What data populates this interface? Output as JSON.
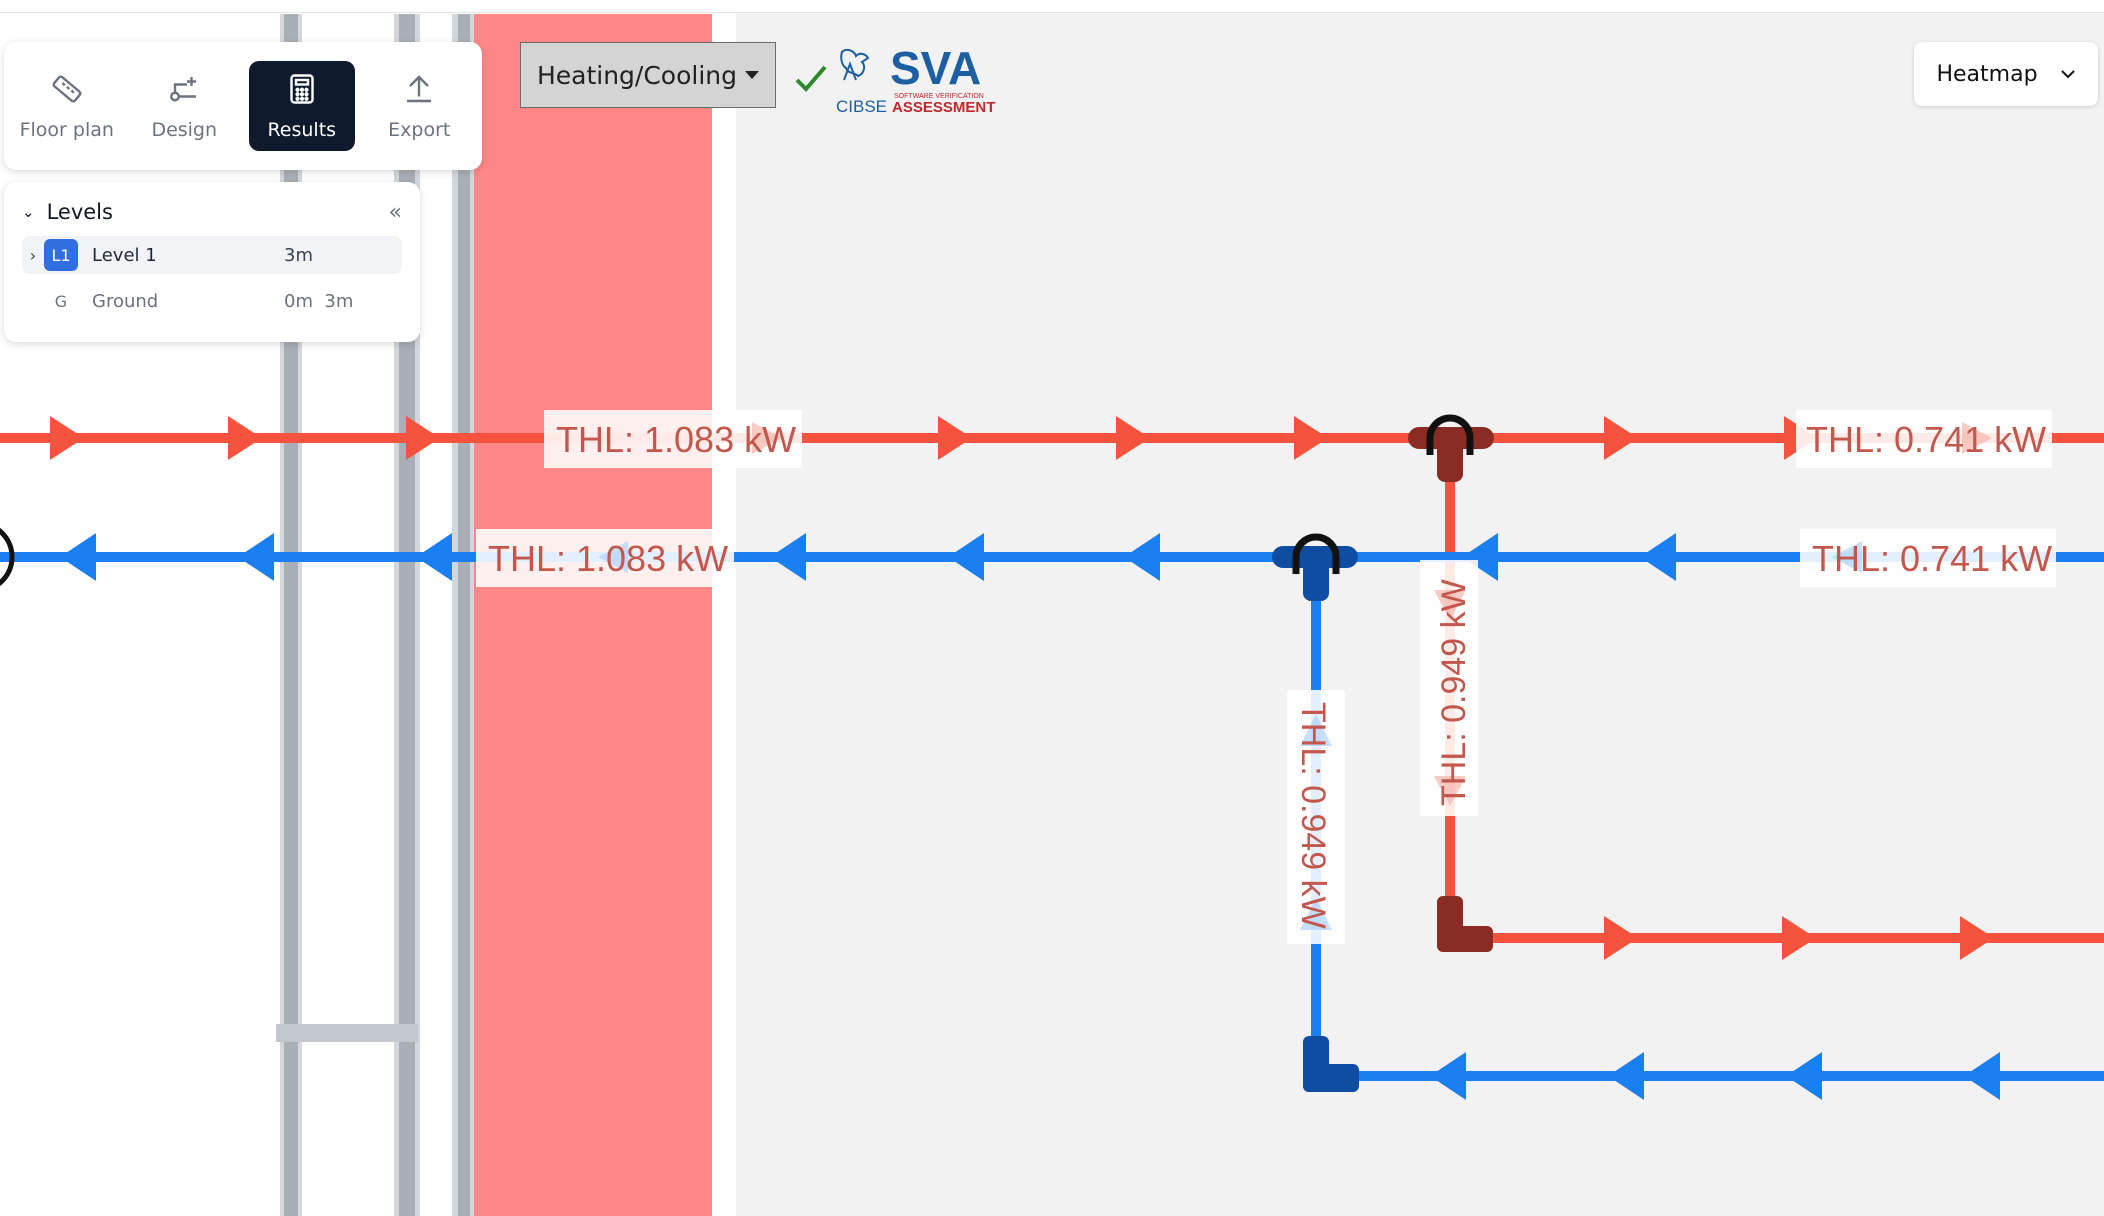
{
  "toolbar": {
    "items": [
      {
        "label": "Floor plan",
        "icon": "ruler-icon"
      },
      {
        "label": "Design",
        "icon": "design-icon"
      },
      {
        "label": "Results",
        "icon": "calculator-icon",
        "active": true
      },
      {
        "label": "Export",
        "icon": "upload-icon"
      }
    ]
  },
  "levels": {
    "title": "Levels",
    "items": [
      {
        "badge": "L1",
        "name": "Level 1",
        "value": "3m",
        "selected": true
      },
      {
        "badge": "G",
        "name": "Ground",
        "value": "0m  3m",
        "selected": false
      }
    ]
  },
  "mode_select": {
    "label": "Heating/Cooling"
  },
  "logo": {
    "brand": "SVA",
    "org": "CIBSE",
    "line1": "SOFTWARE VERIFICATION",
    "line2": "ASSESSMENT"
  },
  "heatmap": {
    "label": "Heatmap"
  },
  "pipe_labels": {
    "flow_main_left": "THL: 1.083 kW",
    "flow_main_right": "THL: 0.741 kW",
    "return_main_left": "THL: 1.083 kW",
    "return_main_right": "THL: 0.741 kW",
    "flow_branch": "THL: 0.949 kW",
    "return_branch": "THL: 0.949 kW"
  },
  "colors": {
    "flow": "#f5533d",
    "return": "#1a7ff0",
    "flow_fitting": "#8b2c24",
    "return_fitting": "#0f4da3",
    "room_fill": "#f2f2f2",
    "wall_band": "#ff8787",
    "dark_panel": "#0f1b2d",
    "accent_blue": "#2f6fe0"
  }
}
